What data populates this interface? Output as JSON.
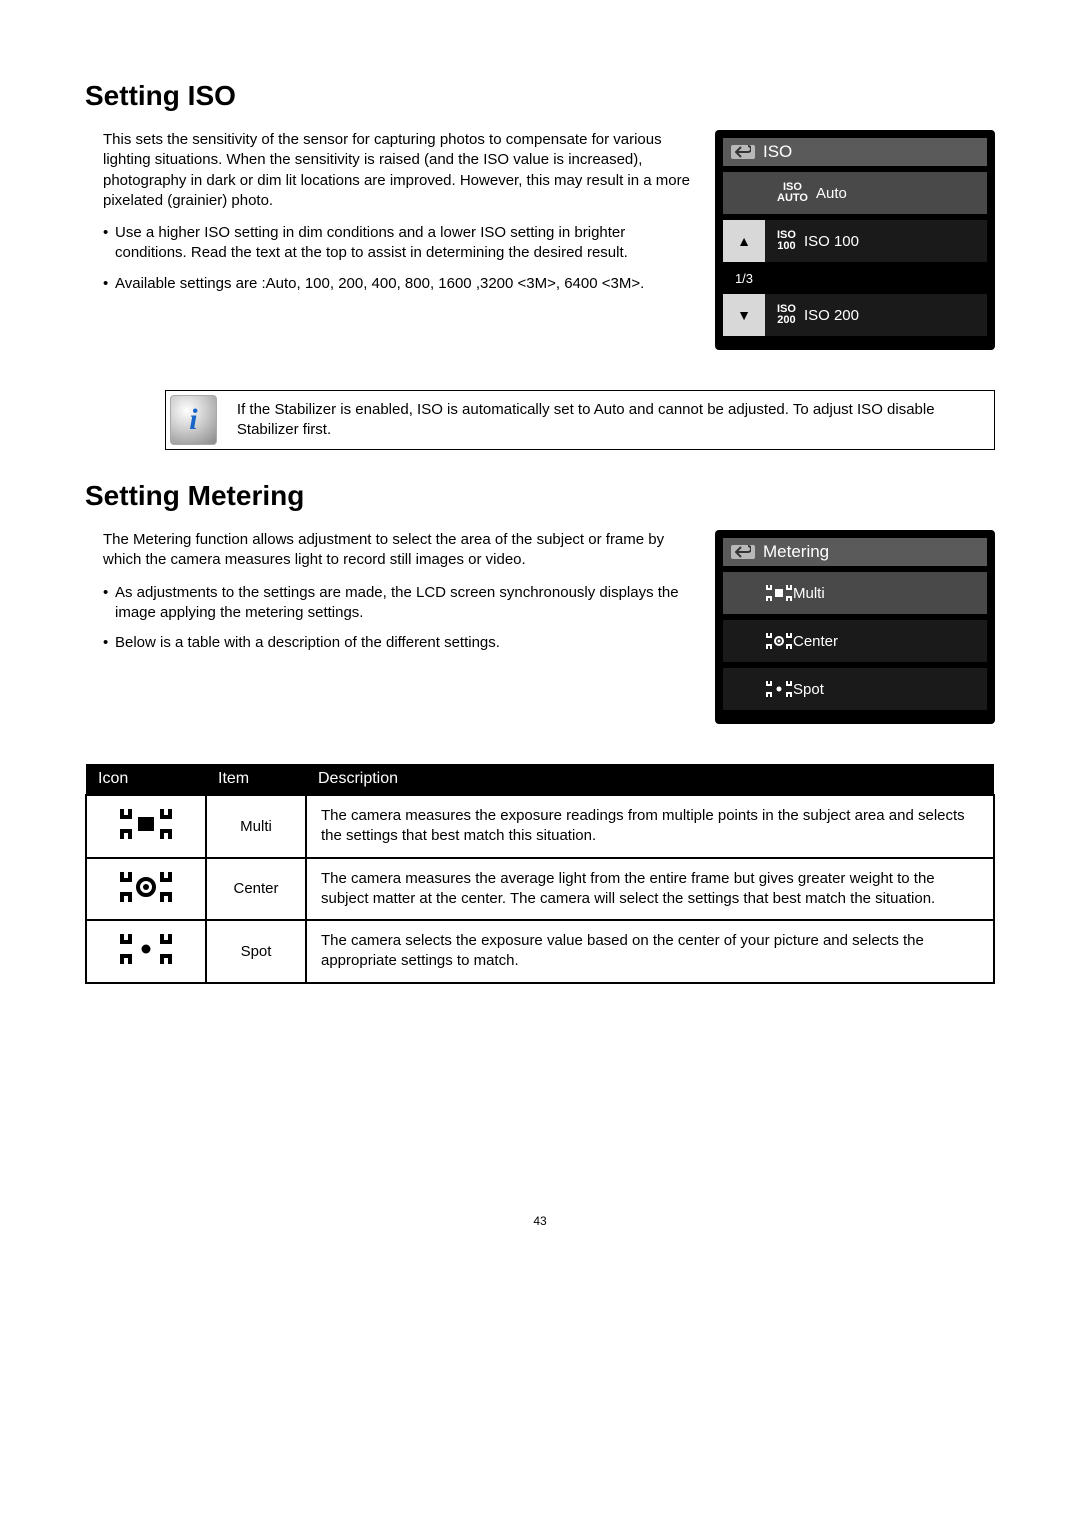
{
  "iso": {
    "heading": "Setting ISO",
    "intro": "This sets the sensitivity of the sensor for capturing photos to compensate for various lighting situations.  When the sensitivity is raised (and the ISO value is increased), photography in dark or dim lit locations are improved.  However, this may result in a more pixelated (grainier) photo.",
    "bullets": [
      "Use a higher ISO setting in dim conditions and a lower ISO setting in brighter conditions.  Read the text at the top to assist in determining the desired result.",
      "Available settings are :Auto, 100, 200, 400, 800, 1600 ,3200 <3M>, 6400 <3M>."
    ],
    "menu": {
      "title": "ISO",
      "page_indicator": "1/3",
      "items": [
        {
          "icon_top": "ISO",
          "icon_bottom": "AUTO",
          "label": "Auto",
          "selected": true,
          "left_button": ""
        },
        {
          "icon_top": "ISO",
          "icon_bottom": "100",
          "label": "ISO 100",
          "selected": false,
          "left_button": "up"
        },
        {
          "icon_top": "ISO",
          "icon_bottom": "200",
          "label": "ISO 200",
          "selected": false,
          "left_button": "down"
        }
      ]
    }
  },
  "note": {
    "text": "If the Stabilizer is enabled, ISO is automatically set to Auto and cannot be adjusted. To adjust ISO disable Stabilizer first."
  },
  "metering": {
    "heading": "Setting Metering",
    "intro": "The Metering function allows adjustment to select the area of the subject or frame by which the camera measures light to record still images or video.",
    "bullets": [
      "As adjustments to the settings are made, the LCD screen synchronously displays the image applying the metering settings.",
      "Below is a table with a description of the different settings."
    ],
    "menu": {
      "title": "Metering",
      "items": [
        {
          "label": "Multi",
          "selected": true
        },
        {
          "label": "Center",
          "selected": false
        },
        {
          "label": "Spot",
          "selected": false
        }
      ]
    }
  },
  "table": {
    "headers": {
      "icon": "Icon",
      "item": "Item",
      "description": "Description"
    },
    "rows": [
      {
        "item": "Multi",
        "description": "The camera measures the exposure readings from multiple points in the subject area and selects the settings that best match this situation."
      },
      {
        "item": "Center",
        "description": "The camera measures the average light from the entire frame but gives greater weight to the subject matter at the center.  The camera will select the settings that best match the situation."
      },
      {
        "item": "Spot",
        "description": "The camera selects the exposure value based on the center of your picture and selects the appropriate settings to match."
      }
    ]
  },
  "page_number": "43"
}
